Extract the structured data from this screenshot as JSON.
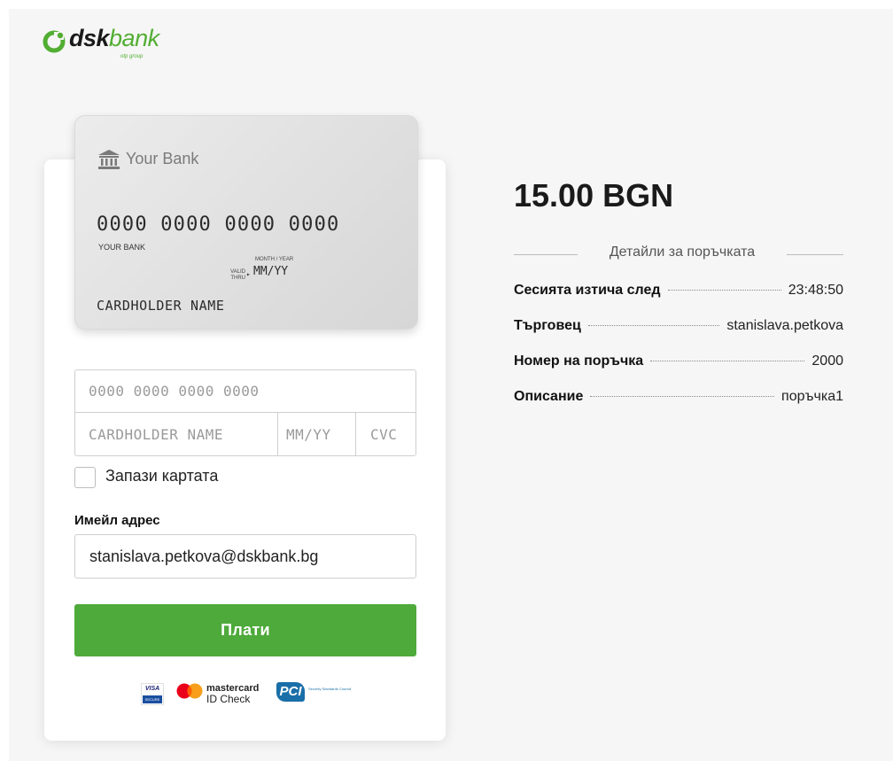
{
  "logo": {
    "dsk": "dsk",
    "bank": "bank",
    "subtitle": "otp group",
    "brand_color": "#52ae32"
  },
  "card_preview": {
    "bank_name": "Your Bank",
    "bank_icon": "bank-icon",
    "number": "0000 0000 0000 0000",
    "bank_small": "YOUR BANK",
    "valid_thru": "VALID THRU",
    "month_year": "MONTH / YEAR",
    "expiry": "MM/YY",
    "holder": "CARDHOLDER NAME"
  },
  "form": {
    "card_number_placeholder": "0000 0000 0000 0000",
    "cardholder_placeholder": "CARDHOLDER NAME",
    "expiry_placeholder": "MM/YY",
    "cvc_placeholder": "CVC",
    "save_card_label": "Запази картата",
    "email_label": "Имейл адрес",
    "email_value": "stanislava.petkova@dskbank.bg",
    "pay_button": "Плати",
    "pay_button_color": "#4eaa3a"
  },
  "badges": {
    "visa": "VISA",
    "visa_sub": "SECURE",
    "mastercard_line1": "mastercard",
    "mastercard_line2": "ID Check",
    "pci": "PCI",
    "pci_text": "Security Standards Council"
  },
  "order": {
    "amount": "15.00 BGN",
    "details_title": "Детайли за поръчката",
    "rows": [
      {
        "label": "Сесията изтича след",
        "value": "23:48:50"
      },
      {
        "label": "Търговец",
        "value": "stanislava.petkova"
      },
      {
        "label": "Номер на поръчка",
        "value": "2000"
      },
      {
        "label": "Описание",
        "value": "поръчка1"
      }
    ]
  }
}
